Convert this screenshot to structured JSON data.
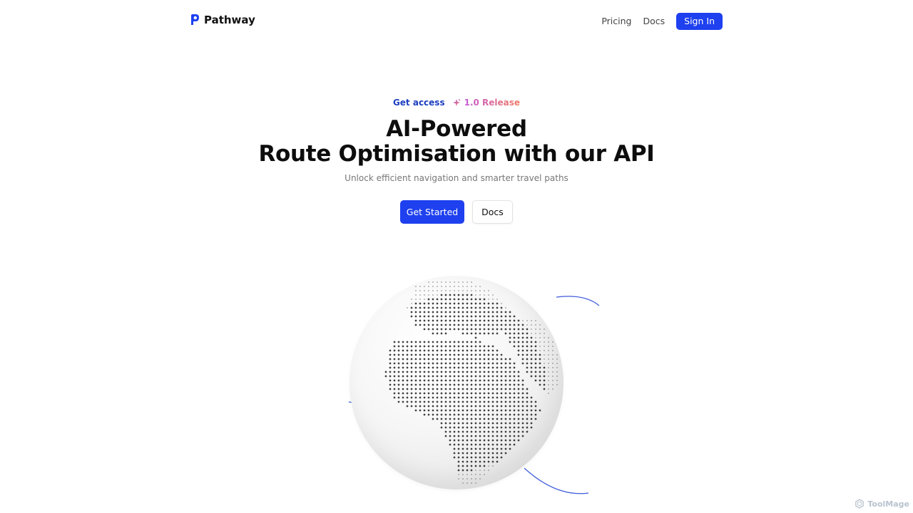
{
  "header": {
    "brand_name": "Pathway",
    "brand_icon": "map-pin-icon",
    "nav": [
      {
        "label": "Pricing"
      },
      {
        "label": "Docs"
      }
    ],
    "signin_label": "Sign In"
  },
  "hero": {
    "badge_access": "Get access",
    "badge_release": "1.0 Release",
    "badge_icon": "sparkle-icon",
    "headline_line1": "AI-Powered",
    "headline_line2": "Route Optimisation with our API",
    "subtitle": "Unlock efficient navigation and smarter travel paths",
    "cta_primary": "Get Started",
    "cta_secondary": "Docs"
  },
  "visual": {
    "globe_icon": "dotted-globe",
    "colors": {
      "accent": "#1e40ef",
      "arc": "#3d5bd9",
      "dot": "#2b2b2b"
    }
  },
  "watermark": {
    "label": "ToolMage"
  }
}
